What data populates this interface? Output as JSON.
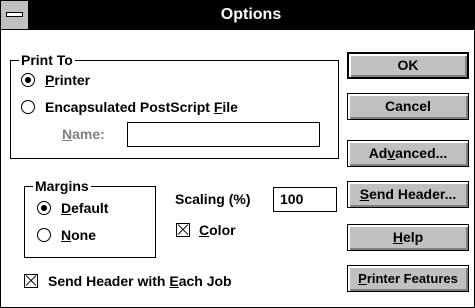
{
  "window": {
    "title": "Options"
  },
  "print_to": {
    "legend": "Print To",
    "options": [
      {
        "pre": "",
        "u": "P",
        "post": "rinter",
        "selected": true
      },
      {
        "pre": "Encapsulated PostScript ",
        "u": "F",
        "post": "ile",
        "selected": false
      }
    ],
    "name_label_u": "N",
    "name_label_rest": "ame:",
    "name_value": ""
  },
  "margins": {
    "legend": "Margins",
    "options": [
      {
        "u": "D",
        "post": "efault",
        "selected": true
      },
      {
        "u": "N",
        "post": "one",
        "selected": false
      }
    ]
  },
  "scaling": {
    "label_pre": "Scalin",
    "label_u": "g",
    "label_post": " (%)",
    "value": "100"
  },
  "color": {
    "u": "C",
    "post": "olor",
    "checked": true
  },
  "send_header_each_job": {
    "pre": "Send Header with ",
    "u": "E",
    "post": "ach Job",
    "checked": true
  },
  "buttons": {
    "ok": "OK",
    "cancel": "Cancel",
    "advanced_pre": "Ad",
    "advanced_u": "v",
    "advanced_post": "anced...",
    "send_header_u": "S",
    "send_header_post": "end Header...",
    "help_u": "H",
    "help_post": "elp",
    "printer_features_u": "P",
    "printer_features_post": "rinter Features"
  }
}
